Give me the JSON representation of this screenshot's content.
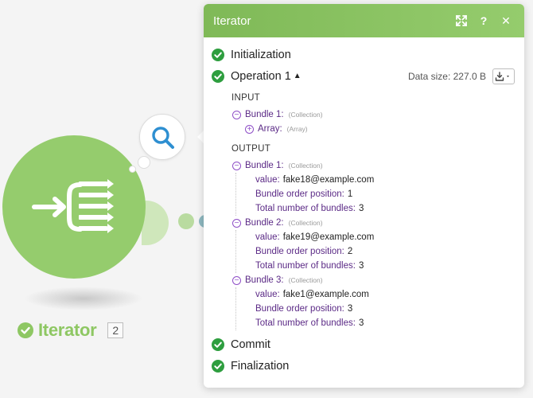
{
  "module": {
    "name": "Iterator",
    "badge": "2",
    "icon": "iterator-icon"
  },
  "panel": {
    "title": "Iterator",
    "header_icons": [
      "expand-icon",
      "help-icon",
      "close-icon"
    ],
    "help_label": "?",
    "close_label": "✕",
    "stages": {
      "initialization": "Initialization",
      "operation": "Operation 1",
      "operation_toggle": "▲",
      "commit": "Commit",
      "finalization": "Finalization"
    },
    "data_size": "Data size: 227.0 B",
    "input": {
      "label": "INPUT",
      "bundle": {
        "key": "Bundle 1:",
        "type": "(Collection)"
      },
      "array": {
        "key": "Array:",
        "type": "(Array)"
      }
    },
    "output": {
      "label": "OUTPUT",
      "bundles": [
        {
          "key": "Bundle 1:",
          "type": "(Collection)",
          "value_key": "value:",
          "value": "fake18@example.com",
          "pos_key": "Bundle order position:",
          "pos": "1",
          "total_key": "Total number of bundles:",
          "total": "3"
        },
        {
          "key": "Bundle 2:",
          "type": "(Collection)",
          "value_key": "value:",
          "value": "fake19@example.com",
          "pos_key": "Bundle order position:",
          "pos": "2",
          "total_key": "Total number of bundles:",
          "total": "3"
        },
        {
          "key": "Bundle 3:",
          "type": "(Collection)",
          "value_key": "value:",
          "value": "fake1@example.com",
          "pos_key": "Bundle order position:",
          "pos": "3",
          "total_key": "Total number of bundles:",
          "total": "3"
        }
      ]
    }
  },
  "colors": {
    "accent": "#95cc6d",
    "success": "#2e9e3f",
    "key": "#5b2a86",
    "toggle": "#8f4fc7"
  }
}
